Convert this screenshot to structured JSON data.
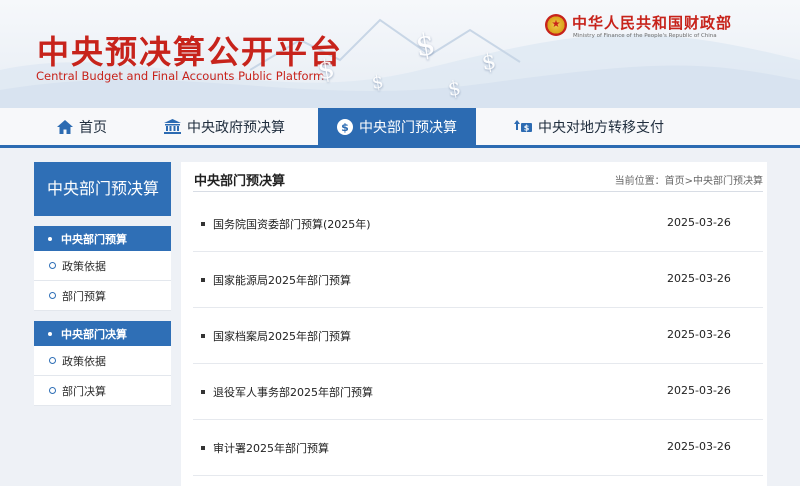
{
  "header": {
    "brand_cn": "中央预决算公开平台",
    "brand_en": "Central Budget and Final Accounts Public Platform",
    "ministry_cn": "中华人民共和国财政部",
    "ministry_en": "Ministry of Finance of the People's Republic of China",
    "brand_color": "#c7231b"
  },
  "nav": {
    "items": [
      {
        "label": "首页",
        "icon": "home-icon"
      },
      {
        "label": "中央政府预决算",
        "icon": "government-building-icon"
      },
      {
        "label": "中央部门预决算",
        "icon": "dollar-coin-icon",
        "active": true
      },
      {
        "label": "中央对地方转移支付",
        "icon": "transfer-icon"
      }
    ],
    "accent_color": "#2c6bb2"
  },
  "sidebar": {
    "title": "中央部门预决算",
    "groups": [
      {
        "section": "中央部门预算",
        "links": [
          "政策依据",
          "部门预算"
        ]
      },
      {
        "section": "中央部门决算",
        "links": [
          "政策依据",
          "部门决算"
        ]
      }
    ]
  },
  "main": {
    "title": "中央部门预决算",
    "breadcrumb": "当前位置：首页>中央部门预决算",
    "items": [
      {
        "title": "国务院国资委部门预算(2025年)",
        "date": "2025-03-26"
      },
      {
        "title": "国家能源局2025年部门预算",
        "date": "2025-03-26"
      },
      {
        "title": "国家档案局2025年部门预算",
        "date": "2025-03-26"
      },
      {
        "title": "退役军人事务部2025年部门预算",
        "date": "2025-03-26"
      },
      {
        "title": "审计署2025年部门预算",
        "date": "2025-03-26"
      }
    ]
  }
}
